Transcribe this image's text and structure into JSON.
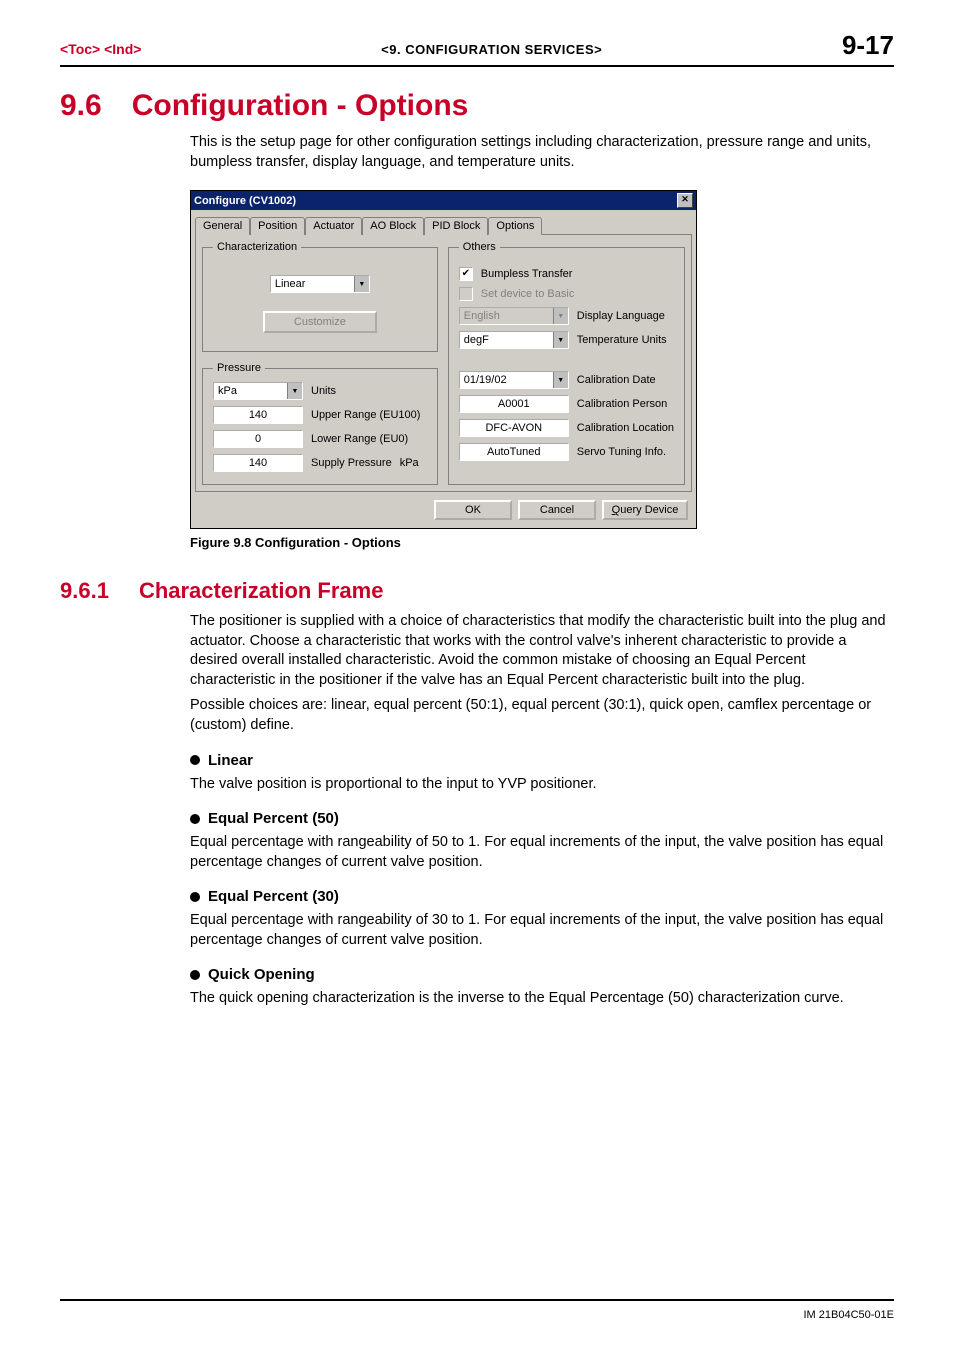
{
  "header": {
    "left": "<Toc> <Ind>",
    "center": "<9.  CONFIGURATION SERVICES>",
    "right": "9-17"
  },
  "section": {
    "number": "9.6",
    "title": "Configuration - Options",
    "intro": "This is the setup page for other configuration settings including characterization, pressure range and units, bumpless transfer, display language, and temperature units."
  },
  "figure_caption": "Figure 9.8  Configuration  - Options",
  "dialog": {
    "title": "Configure (CV1002)",
    "tabs": [
      "General",
      "Position",
      "Actuator",
      "AO Block",
      "PID Block",
      "Options"
    ],
    "active_tab": "Options",
    "characterization": {
      "legend": "Characterization",
      "value": "Linear",
      "customize_btn": "Customize"
    },
    "pressure": {
      "legend": "Pressure",
      "units_label": "Units",
      "units_value": "kPa",
      "upper_label": "Upper Range (EU100)",
      "upper_value": "140",
      "lower_label": "Lower Range (EU0)",
      "lower_value": "0",
      "supply_label": "Supply Pressure",
      "supply_unit": "kPa",
      "supply_value": "140"
    },
    "others": {
      "legend": "Others",
      "bumpless_label": "Bumpless Transfer",
      "bumpless_checked": true,
      "setbasic_label": "Set device to Basic",
      "setbasic_checked": false,
      "lang_label": "Display Language",
      "lang_value": "English",
      "temp_label": "Temperature Units",
      "temp_value": "degF",
      "caldate_label": "Calibration Date",
      "caldate_value": "01/19/02",
      "calperson_label": "Calibration Person",
      "calperson_value": "A0001",
      "calloc_label": "Calibration Location",
      "calloc_value": "DFC-AVON",
      "servo_label": "Servo Tuning Info.",
      "servo_value": "AutoTuned"
    },
    "buttons": {
      "ok": "OK",
      "cancel": "Cancel",
      "query": "Query Device",
      "query_u": "Q"
    }
  },
  "subsection": {
    "number": "9.6.1",
    "title": "Characterization Frame",
    "p1": "The positioner is supplied with a choice of characteristics that modify the characteristic built into the plug and actuator.  Choose a characteristic that works with the control valve's inherent characteristic to provide a desired overall installed characteristic.  Avoid the common mistake of choosing an Equal Percent characteristic in the positioner if the valve has an Equal Percent characteristic built into the plug.",
    "p2": "Possible choices are: linear, equal percent (50:1), equal percent (30:1), quick open, camflex percentage or (custom) define.",
    "items": [
      {
        "title": "Linear",
        "text": "The valve position is proportional to the input to YVP positioner."
      },
      {
        "title": "Equal Percent (50)",
        "text": "Equal percentage with rangeability of 50 to 1.  For equal increments of the input, the valve position has equal percentage changes of current valve position."
      },
      {
        "title": "Equal Percent (30)",
        "text": "Equal percentage with rangeability of 30 to 1.  For equal increments of the input, the valve position has equal percentage changes of current valve position."
      },
      {
        "title": "Quick Opening",
        "text": "The quick opening characterization is the inverse to the Equal Percentage (50) characterization curve."
      }
    ]
  },
  "pubcode": "IM 21B04C50-01E"
}
